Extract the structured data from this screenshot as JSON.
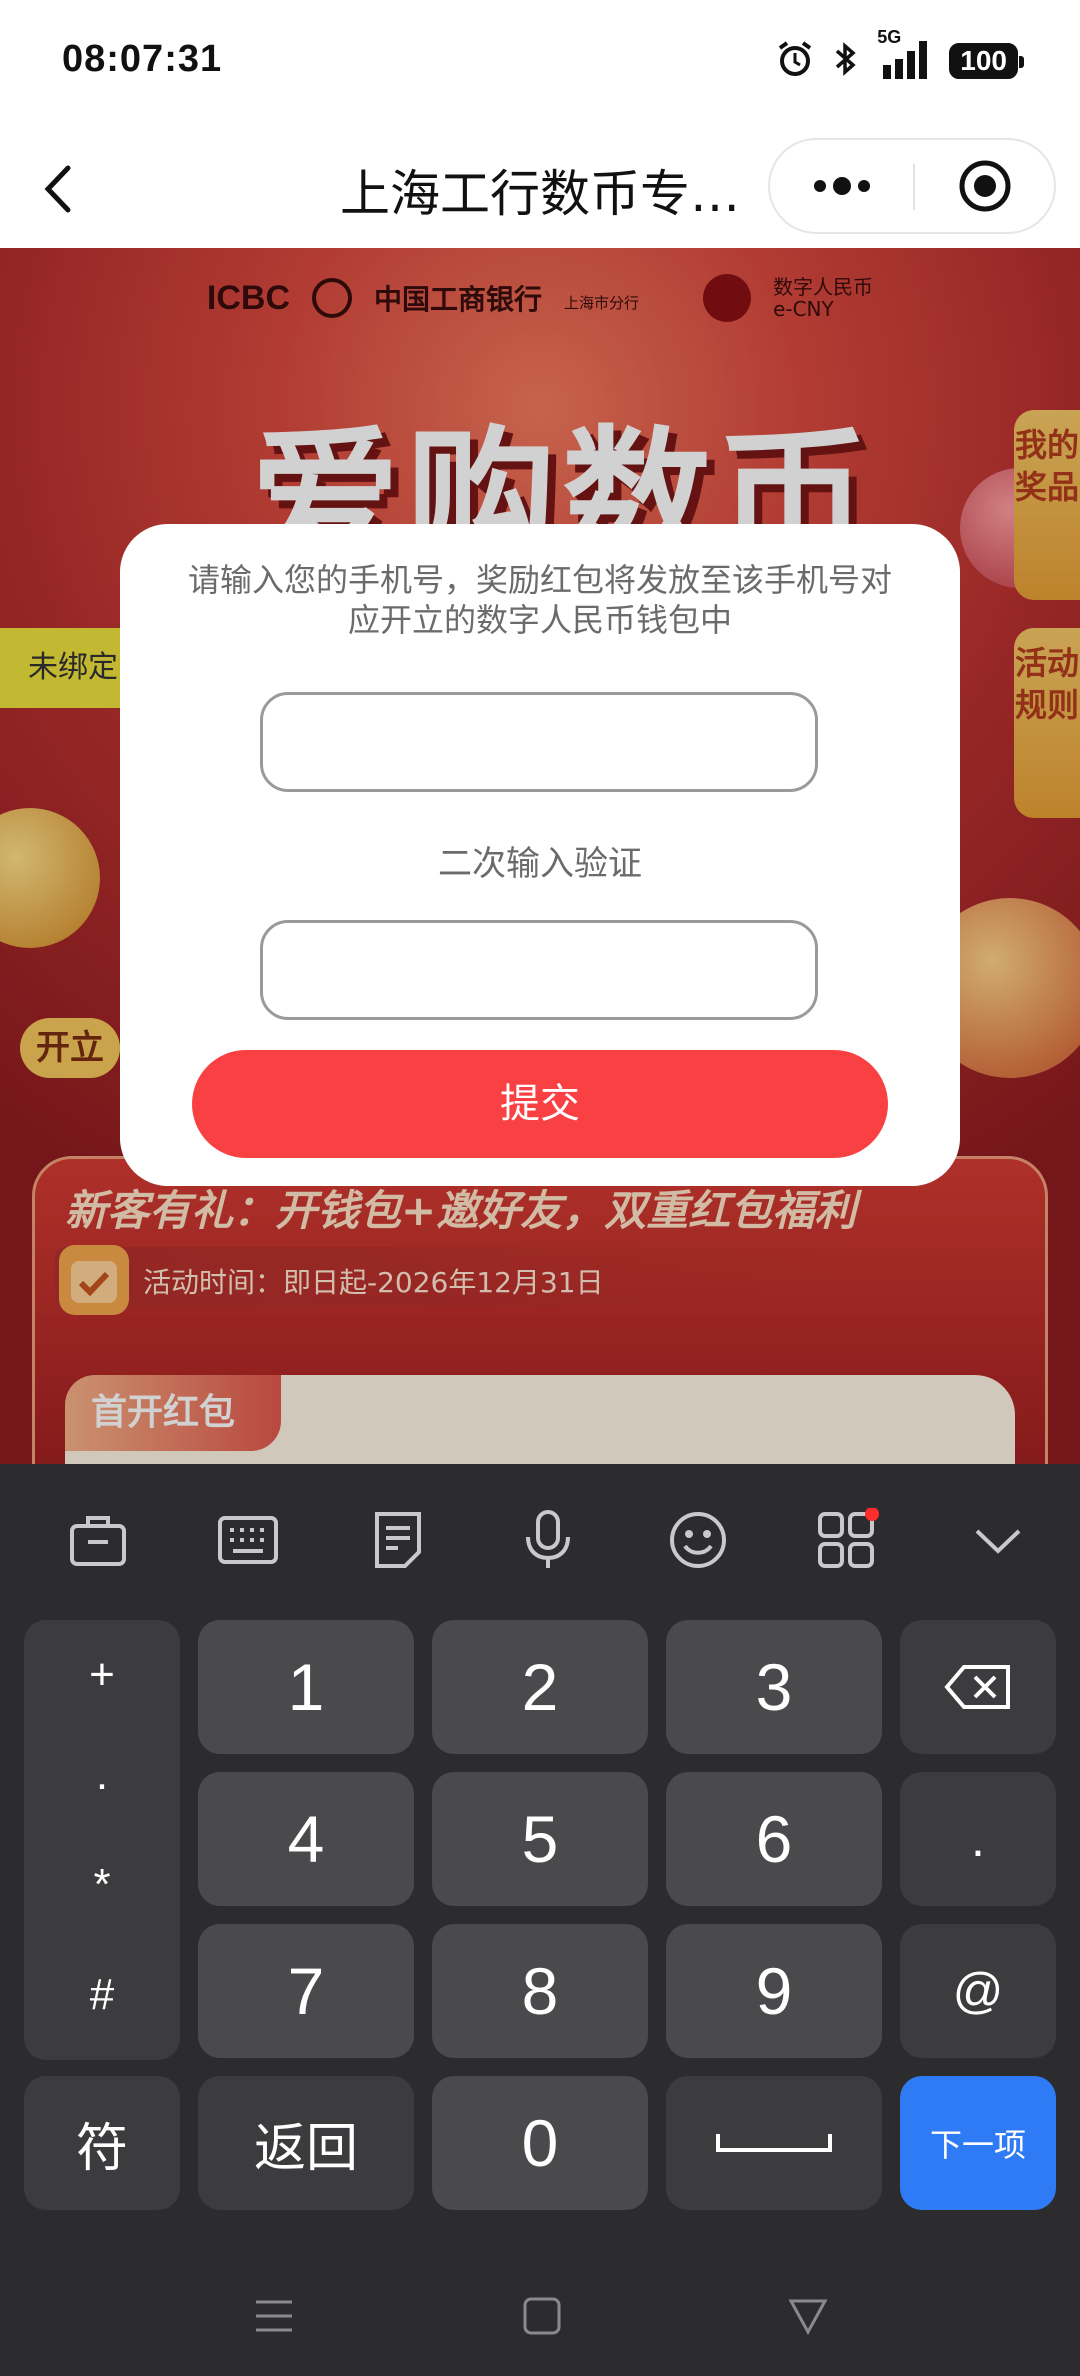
{
  "status_bar": {
    "time": "08:07:31",
    "network": "5G",
    "battery": "100"
  },
  "nav": {
    "title": "上海工行数币专…"
  },
  "banner": {
    "icbc": "ICBC",
    "bank_name": "中国工商银行",
    "branch": "上海市分行",
    "ecny_line1": "数字人民币",
    "ecny_line2": "e-CNY",
    "hero_text": "爱购数币"
  },
  "side_tabs": [
    "我的奖品",
    "活动规则"
  ],
  "left_chip": "未绑定",
  "open_chip": "开立",
  "card": {
    "title": "新客有礼：开钱包+邀好友，双重红包福利",
    "date": "活动时间：即日起-2026年12月31日",
    "tag": "首开红包"
  },
  "modal": {
    "message": "请输入您的手机号，奖励红包将发放至该手机号对应开立的数字人民币钱包中",
    "phone_value": "",
    "confirm_label": "二次输入验证",
    "confirm_value": "",
    "submit_label": "提交"
  },
  "keyboard": {
    "toolbar_icons": [
      "toolbox-icon",
      "keyboard-icon",
      "clipboard-icon",
      "microphone-icon",
      "emoji-icon",
      "apps-icon",
      "collapse-icon"
    ],
    "symbols": [
      "+",
      ".",
      "*",
      "#"
    ],
    "digits": [
      "1",
      "2",
      "3",
      "4",
      "5",
      "6",
      "7",
      "8",
      "9",
      "0"
    ],
    "dot": ".",
    "at": "@",
    "symbol_key": "符",
    "back_key": "返回",
    "next_key": "下一项"
  }
}
